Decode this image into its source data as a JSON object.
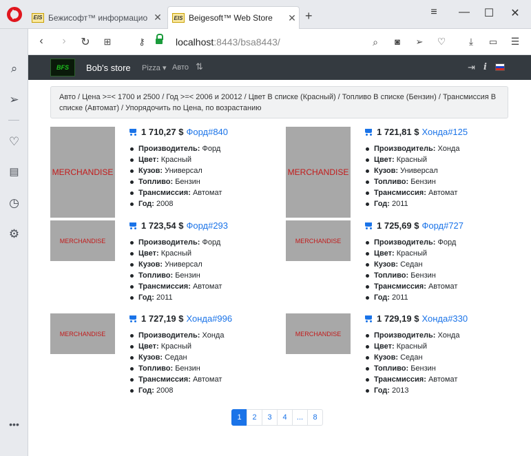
{
  "browser": {
    "tabs": [
      {
        "favicon": "EIS",
        "title": "Бежисофт™ информацио",
        "active": false
      },
      {
        "favicon": "EIS",
        "title": "Beigesoft™ Web Store",
        "active": true
      }
    ],
    "url_host": "localhost",
    "url_rest": ":8443/bsa8443/",
    "icons": {
      "back": "back-icon",
      "forward": "forward-icon",
      "reload": "reload-icon",
      "speeddial": "grid-icon",
      "security": "key-icon",
      "snapshot": "camera-icon",
      "send": "send-icon",
      "bookmark": "heart-icon",
      "download": "download-icon",
      "battery": "battery-icon",
      "easy_setup": "sliders-icon"
    }
  },
  "sidebar": {
    "items": [
      "search-icon",
      "send-icon",
      "heart-icon",
      "news-icon",
      "history-icon",
      "settings-icon",
      "more-icon"
    ]
  },
  "store": {
    "brand_logo": "BFS",
    "brand_name": "Bob's store",
    "nav_pizza": "Pizza",
    "nav_auto": "Авто",
    "breadcrumb": "Авто / Цена >=< 1700 и 2500 / Год >=< 2006 и 20012 / Цвет В списке (Красный) / Топливо В списке (Бензин) / Трансмиссия В списке (Автомат) / Упорядочить по Цена, по возрастанию",
    "flag_colors": [
      "#ffffff",
      "#1c3fbf",
      "#d52b1e"
    ],
    "accent": "#1a73e8"
  },
  "labels": {
    "maker": "Производитель:",
    "color": "Цвет:",
    "body": "Кузов:",
    "fuel": "Топливо:",
    "trans": "Трансмиссия:",
    "year": "Год:"
  },
  "products": [
    {
      "image": "MERCHANDISE",
      "price": "1 710,27 $",
      "name": "Форд#840",
      "maker": "Форд",
      "color": "Красный",
      "body": "Универсал",
      "fuel": "Бензин",
      "trans": "Автомат",
      "year": "2008"
    },
    {
      "image": "MERCHANDISE",
      "price": "1 721,81 $",
      "name": "Хонда#125",
      "maker": "Хонда",
      "color": "Красный",
      "body": "Универсал",
      "fuel": "Бензин",
      "trans": "Автомат",
      "year": "2011"
    },
    {
      "image": "MERCHANDISE",
      "price": "1 723,54 $",
      "name": "Форд#293",
      "maker": "Форд",
      "color": "Красный",
      "body": "Универсал",
      "fuel": "Бензин",
      "trans": "Автомат",
      "year": "2011"
    },
    {
      "image": "MERCHANDISE",
      "price": "1 725,69 $",
      "name": "Форд#727",
      "maker": "Форд",
      "color": "Красный",
      "body": "Седан",
      "fuel": "Бензин",
      "trans": "Автомат",
      "year": "2011"
    },
    {
      "image": "MERCHANDISE",
      "price": "1 727,19 $",
      "name": "Хонда#996",
      "maker": "Хонда",
      "color": "Красный",
      "body": "Седан",
      "fuel": "Бензин",
      "trans": "Автомат",
      "year": "2008"
    },
    {
      "image": "MERCHANDISE",
      "price": "1 729,19 $",
      "name": "Хонда#330",
      "maker": "Хонда",
      "color": "Красный",
      "body": "Седан",
      "fuel": "Бензин",
      "trans": "Автомат",
      "year": "2013"
    }
  ],
  "pagination": [
    "1",
    "2",
    "3",
    "4",
    "...",
    "8"
  ],
  "current_page": "1"
}
